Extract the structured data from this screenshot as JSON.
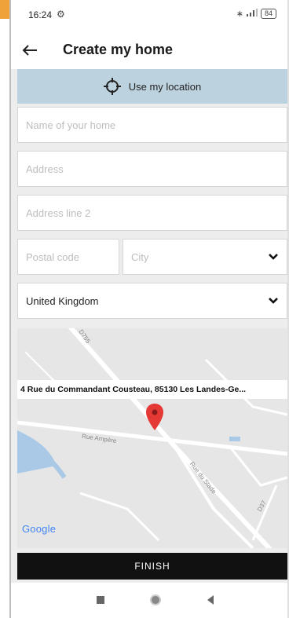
{
  "status_bar": {
    "time": "16:24",
    "battery": "84"
  },
  "app_bar": {
    "title": "Create my home"
  },
  "location": {
    "label": "Use my location"
  },
  "form": {
    "home_name_placeholder": "Name of your home",
    "address_placeholder": "Address",
    "address2_placeholder": "Address line 2",
    "postal_code_placeholder": "Postal code",
    "city_placeholder": "City",
    "country_value": "United Kingdom"
  },
  "map": {
    "address": "4 Rue du Commandant Cousteau, 85130 Les Landes-Ge...",
    "road_labels": {
      "d755": "D755",
      "ampere": "Rue Ampère",
      "stade": "Rue du Stade",
      "d37": "D37"
    },
    "provider_logo": "Google"
  },
  "actions": {
    "finish_label": "FINISH"
  },
  "colors": {
    "location_bar": "#bcd3df",
    "pin": "#e53935",
    "finish_button": "#111111"
  }
}
